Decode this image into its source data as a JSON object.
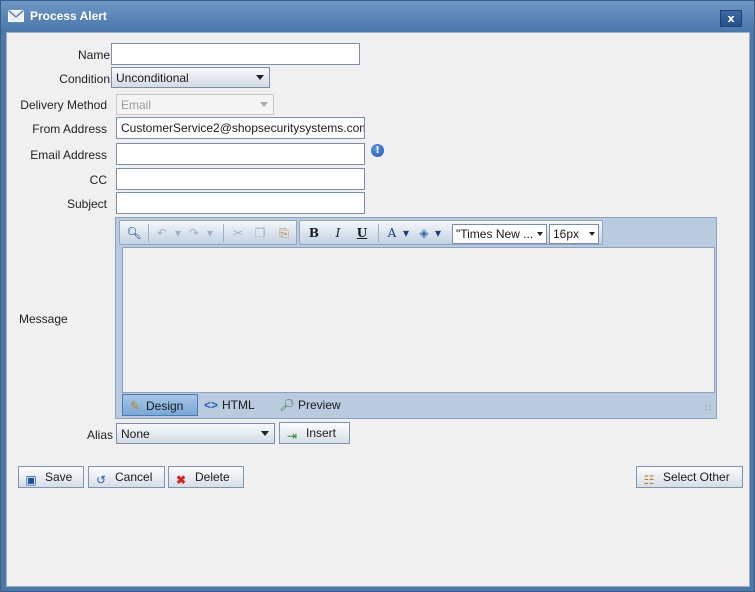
{
  "window": {
    "title": "Process Alert",
    "close_glyph": "x"
  },
  "form": {
    "name": {
      "label": "Name",
      "value": ""
    },
    "condition": {
      "label": "Condition",
      "value": "Unconditional"
    },
    "delivery_method": {
      "label": "Delivery Method",
      "value": "Email",
      "disabled": true
    },
    "from_address": {
      "label": "From Address",
      "value": "CustomerService2@shopsecuritysystems.com"
    },
    "email_address": {
      "label": "Email Address",
      "value": ""
    },
    "cc": {
      "label": "CC",
      "value": ""
    },
    "subject": {
      "label": "Subject",
      "value": ""
    },
    "message": {
      "label": "Message"
    },
    "alias": {
      "label": "Alias",
      "value": "None",
      "insert_label": "Insert"
    }
  },
  "editor": {
    "toolbar": {
      "icons": [
        "find-icon",
        "undo-icon",
        "redo-icon",
        "cut-icon",
        "copy-icon",
        "paste-icon",
        "bold-icon",
        "italic-icon",
        "underline-icon",
        "font-color-icon",
        "highlight-icon"
      ],
      "font_family": "\"Times New ...",
      "font_size": "16px"
    },
    "modes": {
      "design": "Design",
      "html": "HTML",
      "preview": "Preview"
    },
    "active_mode": "Design"
  },
  "buttons": {
    "save": "Save",
    "cancel": "Cancel",
    "delete": "Delete",
    "select_other": "Select Other"
  },
  "colors": {
    "title_bar": "#4a76aa",
    "accent": "#2a5db0",
    "info": "#1f56b7",
    "delete": "#d42222"
  }
}
